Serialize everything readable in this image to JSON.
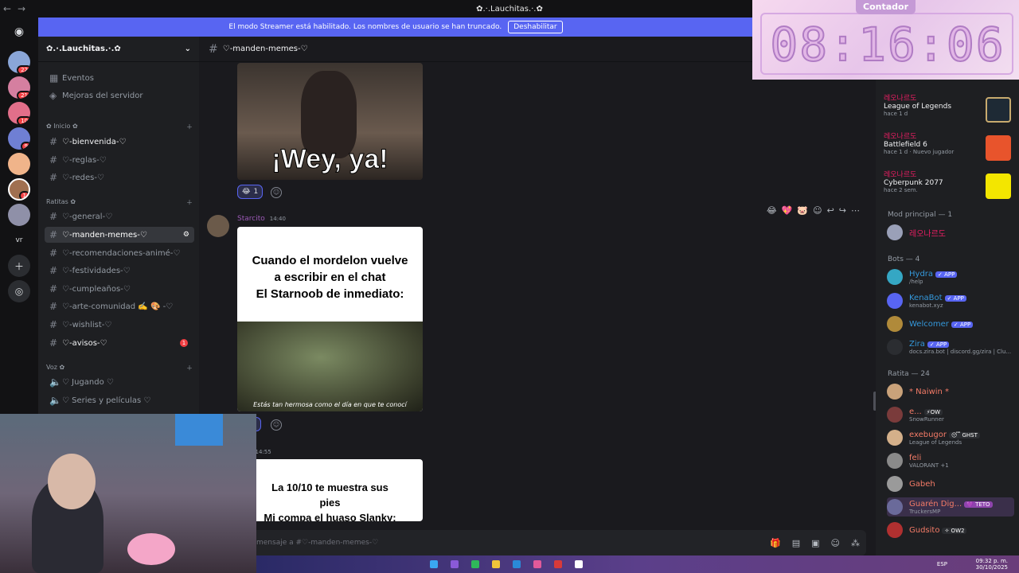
{
  "window": {
    "title": "✿.·.Lauchitas.·.✿"
  },
  "streamer_banner": {
    "text": "El modo Streamer está habilitado. Los nombres de usuario se han truncado.",
    "button": "Deshabilitar"
  },
  "guild_rail": {
    "badges": [
      "22",
      "21",
      "10",
      "9",
      "1"
    ],
    "vr_label": "vr"
  },
  "server": {
    "name": "✿.·.Lauchitas.·.✿",
    "top_items": [
      {
        "label": "Eventos",
        "icon": "calendar-icon"
      },
      {
        "label": "Mejoras del servidor",
        "icon": "boost-icon"
      }
    ],
    "categories": [
      {
        "label": "✿ Inicio ✿",
        "channels": [
          "♡-bienvenida-♡",
          "♡-reglas-♡",
          "♡-redes-♡"
        ]
      },
      {
        "label": "Ratitas ✿",
        "channels": [
          "♡-general-♡",
          "♡-manden-memes-♡",
          "♡-recomendaciones-animé-♡",
          "♡-festividades-♡",
          "♡-cumpleaños-♡",
          "♡-arte-comunidad ✍️ 🎨 -♡",
          "♡-wishlist-♡",
          "♡-avisos-♡"
        ]
      },
      {
        "label": "Voz ✿",
        "channels": [
          "♡ Jugando ♡",
          "♡ Series y películas ♡"
        ]
      }
    ],
    "avisos_badge": "1"
  },
  "chat": {
    "channel": "♡-manden-memes-♡",
    "messages": [
      {
        "image_text": "¡Wey, ya!",
        "reaction_count": "1"
      },
      {
        "author": "Starcito",
        "time": "14:40",
        "image_text": [
          "Cuando el mordelon vuelve",
          "a escribir en el chat",
          "El Starnoob de inmediato:"
        ],
        "caption": "Estás tan hermosa como el día en que te conocí",
        "reaction_count": "1"
      },
      {
        "author": "cito",
        "time": "14:55",
        "image_text": [
          "La 10/10 te muestra sus",
          "pies",
          "Mi compa el huaso Slanky:"
        ]
      }
    ],
    "composer_placeholder": "mensaje a #♡-manden-memes-♡"
  },
  "members": {
    "activities": [
      {
        "name": "레오나르도",
        "game": "League of Legends",
        "time": "hace 1 d",
        "extra": "",
        "color": "#c8aa6e"
      },
      {
        "name": "레오나르도",
        "game": "Battlefield 6",
        "time": "hace 1 d",
        "extra": "Nuevo jugador",
        "color": "#e8542c"
      },
      {
        "name": "레오나르도",
        "game": "Cyberpunk 2077",
        "time": "hace 2 sem.",
        "extra": "",
        "color": "#f3e600"
      }
    ],
    "sections": [
      {
        "title": "Mod principal — 1",
        "members": [
          {
            "name": "레오나르도",
            "sub": "",
            "color": "#e91e63",
            "tag": ""
          }
        ]
      },
      {
        "title": "Bots — 4",
        "members": [
          {
            "name": "Hydra",
            "sub": "/help",
            "color": "#3498db",
            "tag": "✓ APP"
          },
          {
            "name": "KenaBot",
            "sub": "kenabot.xyz",
            "color": "#3498db",
            "tag": "✓ APP"
          },
          {
            "name": "Welcomer",
            "sub": "",
            "color": "#3498db",
            "tag": "✓ APP"
          },
          {
            "name": "Zira",
            "sub": "docs.zira.bot | discord.gg/zira | Clu...",
            "color": "#3498db",
            "tag": "✓ APP"
          }
        ]
      },
      {
        "title": "Ratita — 24",
        "members": [
          {
            "name": "* Naiwin *",
            "sub": "",
            "color": "#f47b67",
            "tag": ""
          },
          {
            "name": "e...",
            "sub": "SnowRunner",
            "color": "#f47b67",
            "tag": "⚡OW"
          },
          {
            "name": "exebugor",
            "sub": "League of Legends",
            "color": "#f47b67",
            "tag": "😴 GHST"
          },
          {
            "name": "feli",
            "sub": "VALORANT +1",
            "color": "#f47b67",
            "tag": ""
          },
          {
            "name": "Gabeh",
            "sub": "",
            "color": "#f47b67",
            "tag": ""
          },
          {
            "name": "Guarén Dig...",
            "sub": "TruckersMP",
            "color": "#f47b67",
            "tag": "💜 TETO"
          },
          {
            "name": "Gudsito",
            "sub": "",
            "color": "#f47b67",
            "tag": "✧ OW2"
          }
        ]
      }
    ]
  },
  "timer_overlay": {
    "label": "Contador",
    "value": "08:16:06"
  },
  "taskbar": {
    "lang": "ESP",
    "time": "09:32 p. m.",
    "date": "30/10/2025"
  },
  "colors": {
    "blurple": "#5865f2",
    "sidebar": "#1e1f22",
    "chat": "#1a1a1e"
  }
}
